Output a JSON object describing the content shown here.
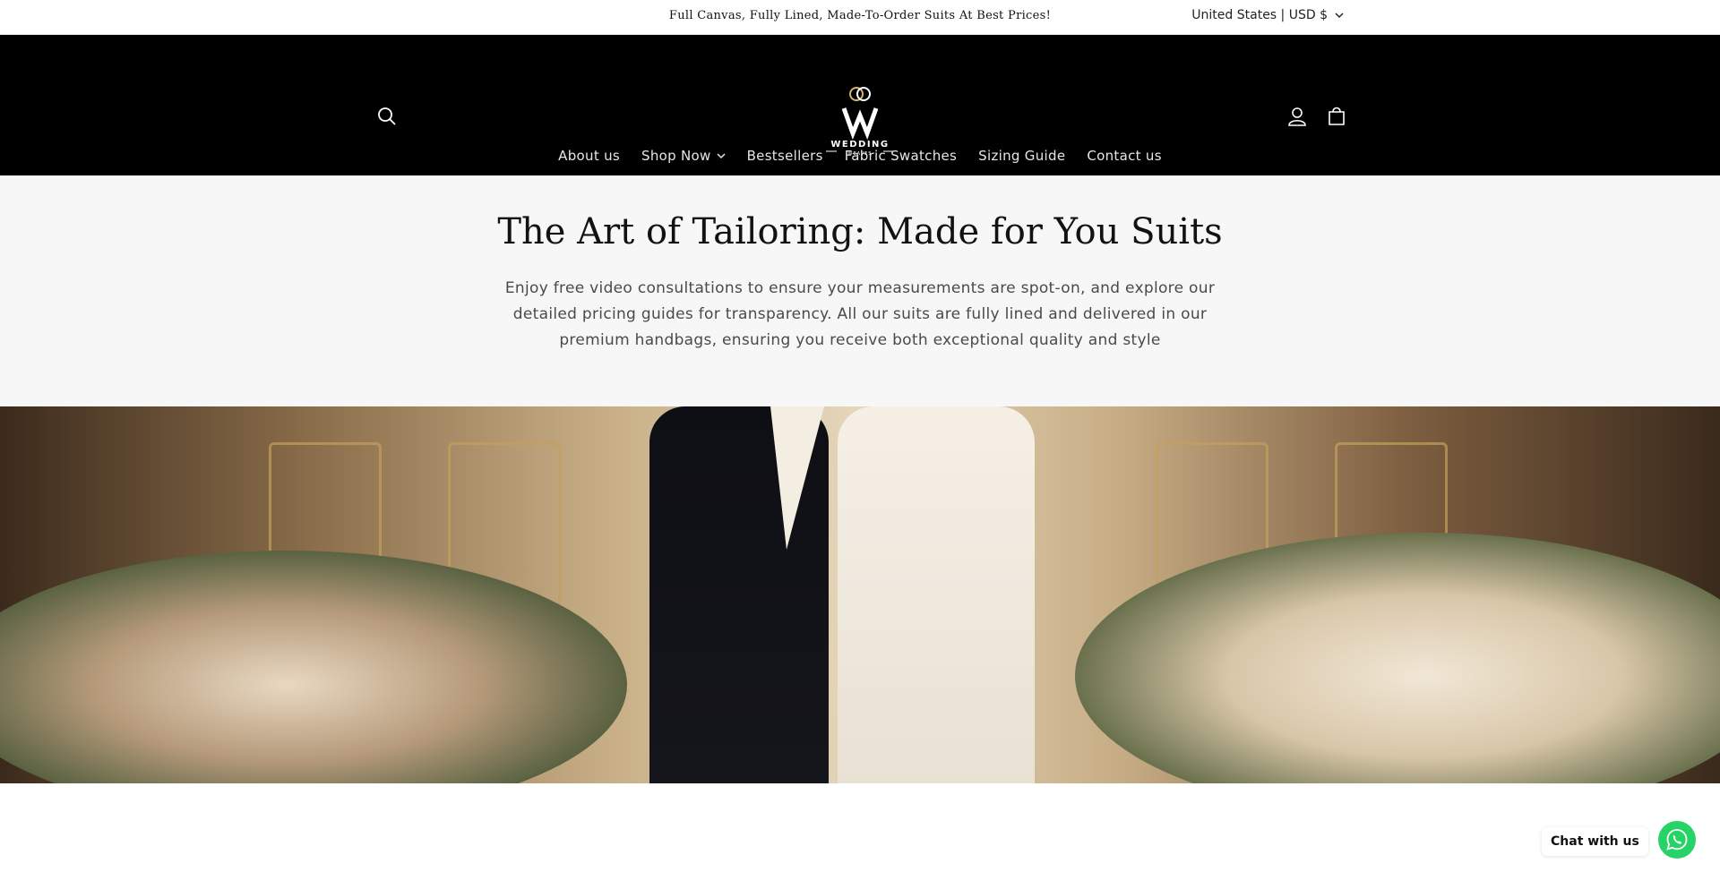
{
  "announcement": {
    "text": "Full Canvas, Fully Lined, Made-To-Order Suits At Best Prices!"
  },
  "localization": {
    "selected": "United States | USD $"
  },
  "header": {
    "logo_text": "WEDDING",
    "logo_subtext": "WEAVES",
    "icons": [
      "search-icon",
      "account-icon",
      "cart-icon"
    ]
  },
  "nav": {
    "items": [
      {
        "label": "About us"
      },
      {
        "label": "Shop Now"
      },
      {
        "label": "Bestsellers"
      },
      {
        "label": "Fabric Swatches"
      },
      {
        "label": "Sizing Guide"
      },
      {
        "label": "Contact us"
      }
    ]
  },
  "hero": {
    "title": "The Art of Tailoring: Made for You Suits",
    "description": "Enjoy free video consultations to ensure your measurements are spot-on, and explore our detailed pricing guides for transparency. All our suits are fully lined and delivered in our premium handbags, ensuring you receive both exceptional quality and style"
  },
  "chat": {
    "label": "Chat with us"
  },
  "colors": {
    "header_bg": "#000000",
    "hero_bg": "#f7f7f7",
    "whatsapp": "#25d366"
  }
}
